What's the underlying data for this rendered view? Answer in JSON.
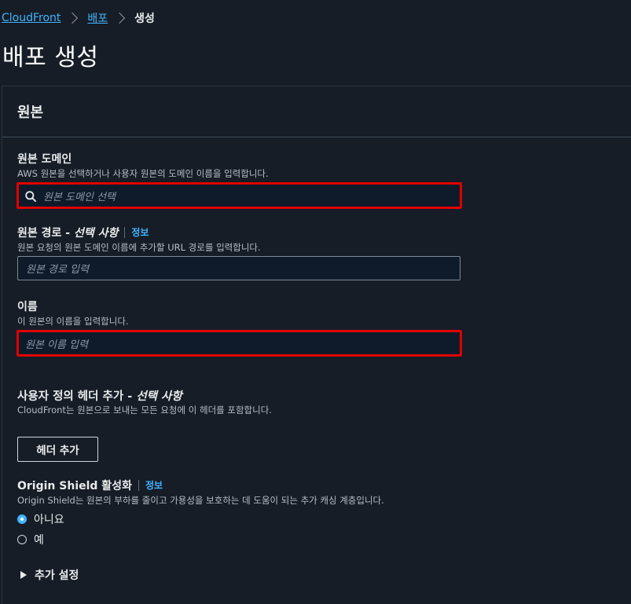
{
  "breadcrumb": {
    "items": [
      "CloudFront",
      "배포"
    ],
    "current": "생성"
  },
  "page": {
    "title": "배포 생성"
  },
  "section": {
    "title": "원본",
    "origin_domain": {
      "label": "원본 도메인",
      "description": "AWS 원본을 선택하거나 사용자 원본의 도메인 이름을 입력합니다.",
      "placeholder": "원본 도메인 선택"
    },
    "origin_path": {
      "label": "원본 경로 - ",
      "optional": "선택 사항",
      "info": "정보",
      "description": "원본 요청의 원본 도메인 이름에 추가할 URL 경로를 입력합니다.",
      "placeholder": "원본 경로 입력"
    },
    "name": {
      "label": "이름",
      "description": "이 원본의 이름을 입력합니다.",
      "placeholder": "원본 이름 입력"
    },
    "custom_headers": {
      "label": "사용자 정의 헤더 추가 - ",
      "optional": "선택 사항",
      "description": "CloudFront는 원본으로 보내는 모든 요청에 이 헤더를 포함합니다.",
      "button": "헤더 추가"
    },
    "origin_shield": {
      "label": "Origin Shield 활성화",
      "info": "정보",
      "description": "Origin Shield는 원본의 부하를 줄이고 가용성을 보호하는 데 도움이 되는 추가 캐싱 계층입니다.",
      "options": [
        "아니요",
        "예"
      ],
      "selected": "아니요"
    },
    "additional_settings": "추가 설정"
  },
  "colors": {
    "link": "#42b4ff",
    "highlight": "#e00000",
    "background": "#161d26"
  }
}
